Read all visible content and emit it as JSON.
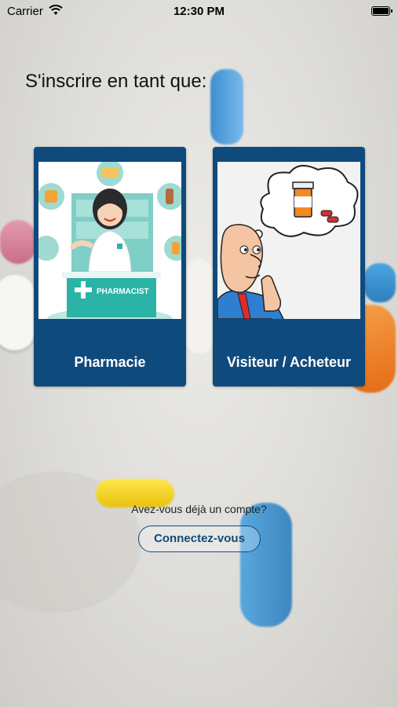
{
  "status_bar": {
    "carrier": "Carrier",
    "time": "12:30 PM"
  },
  "heading": "S'inscrire en tant que:",
  "cards": [
    {
      "label": "Pharmacie",
      "illustration": "pharmacist-illustration",
      "sign_text": "PHARMACIST"
    },
    {
      "label": "Visiteur / Acheteur",
      "illustration": "thinking-man-illustration"
    }
  ],
  "footer": {
    "question": "Avez-vous déjà un compte?",
    "login_label": "Connectez-vous"
  },
  "colors": {
    "card_blue": "#0f4a7c",
    "teal": "#2bb3a7",
    "accent_orange": "#f08a24"
  }
}
